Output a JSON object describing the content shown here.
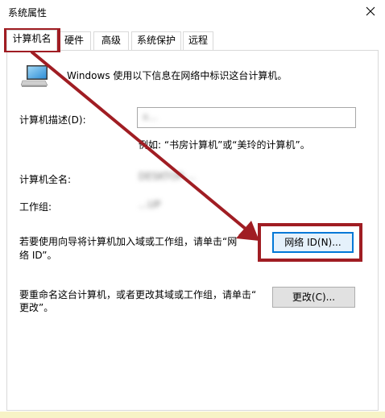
{
  "window": {
    "title": "系统属性"
  },
  "tabs": [
    {
      "label": "计算机名",
      "active": true
    },
    {
      "label": "硬件",
      "active": false
    },
    {
      "label": "高级",
      "active": false
    },
    {
      "label": "系统保护",
      "active": false
    },
    {
      "label": "远程",
      "active": false
    }
  ],
  "intro": {
    "icon": "computer-monitor-icon",
    "text": "Windows 使用以下信息在网络中标识这台计算机。"
  },
  "computer_description": {
    "label": "计算机描述(D):",
    "value": "x...",
    "hint": "例如: “书房计算机”或“美玲的计算机”。"
  },
  "full_name": {
    "label": "计算机全名:",
    "value": "DESKTOP-..."
  },
  "workgroup": {
    "label": "工作组:",
    "value": "...UP"
  },
  "network_id": {
    "text_line1": "若要使用向导将计算机加入域或工作组，请单击“网",
    "text_line2": "络 ID”。",
    "button_label": "网络 ID(N)..."
  },
  "rename": {
    "text_line1": "要重命名这台计算机，或者更改其域或工作组，请单击“",
    "text_line2": "更改”。",
    "button_label": "更改(C)..."
  },
  "annotation": {
    "color": "#a01d23"
  }
}
